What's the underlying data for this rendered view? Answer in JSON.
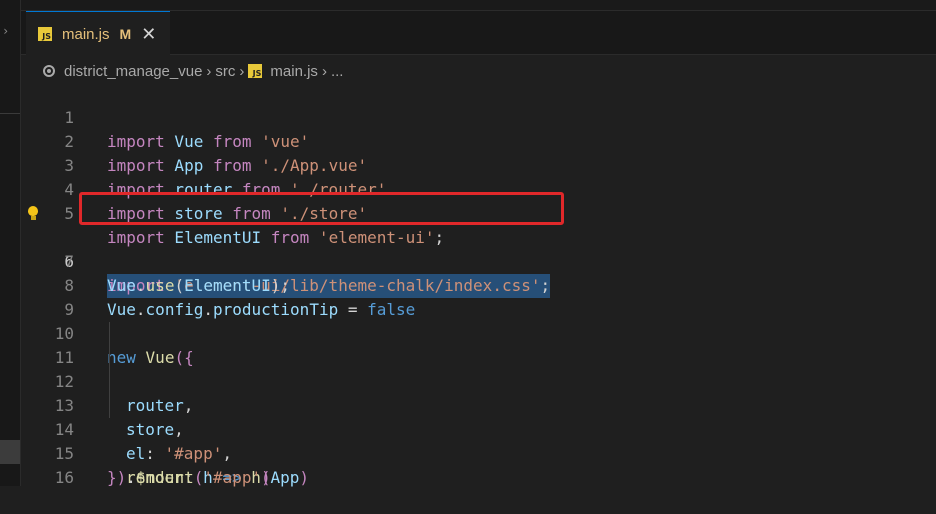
{
  "tab": {
    "filename": "main.js",
    "status": "M",
    "close_glyph": "✕",
    "icon": "js-file-icon"
  },
  "breadcrumb": {
    "repo": "district_manage_vue",
    "folder": "src",
    "file": "main.js",
    "more": "...",
    "separator": "›"
  },
  "colors": {
    "keyword": "#c586c0",
    "string": "#ce9178",
    "variable": "#9cdcfe",
    "selection": "#264f78",
    "highlight_border": "#e0282a"
  },
  "code": {
    "lines": [
      {
        "n": "1",
        "t": [
          "import",
          " Vue ",
          "from",
          " 'vue'"
        ]
      },
      {
        "n": "2",
        "t": [
          "import",
          " App ",
          "from",
          " './App.vue'"
        ]
      },
      {
        "n": "3",
        "t": [
          "import",
          " router ",
          "from",
          " './router'"
        ]
      },
      {
        "n": "4",
        "t": [
          "import",
          " store ",
          "from",
          " './store'"
        ]
      },
      {
        "n": "5",
        "t": [
          "import",
          " ElementUI ",
          "from",
          " 'element-ui'",
          ";"
        ]
      },
      {
        "n": "6",
        "t": [
          "import",
          " 'element-ui/lib/theme-chalk/index.css'",
          ";"
        ]
      },
      {
        "n": "7",
        "t": [
          "Vue",
          ".",
          "use",
          "(",
          "ElementUI",
          ");"
        ]
      },
      {
        "n": "8",
        "t": [
          "Vue",
          ".",
          "config",
          ".",
          "productionTip",
          " = ",
          "false"
        ]
      },
      {
        "n": "9",
        "t": []
      },
      {
        "n": "10",
        "t": [
          "new",
          " ",
          "Vue",
          "({"
        ]
      },
      {
        "n": "11",
        "t": [
          "router",
          ","
        ]
      },
      {
        "n": "12",
        "t": [
          "store",
          ","
        ]
      },
      {
        "n": "13",
        "t": [
          "el",
          ": ",
          "'#app'",
          ","
        ]
      },
      {
        "n": "14",
        "t": [
          "render",
          ": ",
          "h",
          " => ",
          "h",
          "(",
          "App",
          ")"
        ]
      },
      {
        "n": "15",
        "t": [
          "})",
          ".",
          "$mount",
          "(",
          "'#app'",
          ")"
        ]
      },
      {
        "n": "16",
        "t": []
      }
    ]
  }
}
